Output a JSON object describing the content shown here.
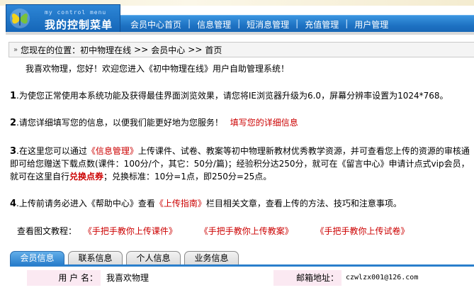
{
  "header": {
    "logo_en": "my control menu",
    "logo_cn": "我的控制菜单",
    "nav": [
      "会员中心首页",
      "信息管理",
      "短消息管理",
      "充值管理",
      "用户管理"
    ],
    "nav_separator": "|"
  },
  "breadcrumb": {
    "prefix": "您现在的位置：",
    "items": [
      "初中物理在线",
      "会员中心",
      "首页"
    ],
    "separator": ">>"
  },
  "content": {
    "greeting": "我喜欢物理，您好！欢迎您进入《初中物理在线》用户自助管理系统！",
    "item1": {
      "num": "1",
      "text": ".为使您正常使用本系统功能及获得最佳界面浏览效果，请您将IE浏览器升级为6.0，屏幕分辨率设置为1024*768。"
    },
    "item2": {
      "num": "2",
      "text": ".请您详细填写您的信息，以便我们能更好地为您服务！",
      "link": "填写您的详细信息"
    },
    "item3": {
      "num": "3",
      "text_a": ".在这里您可以通过",
      "link_a": "《信息管理》",
      "text_b": "上传课件、试卷、教案等初中物理新教材优秀教学资源，并可查看您上传的资源的审核通",
      "line2": "即可给您赠送下载点数(课件：100分/个，其它：50分/篇)；经验积分达250分，就可在《留言中心》申请计点式vip会员，",
      "line3_a": "就可在这里自行",
      "link_b": "兑换点券",
      "line3_b": "；兑换标准：10分=1点，即250分=25点。"
    },
    "item4": {
      "num": "4",
      "text_a": ".上传前请务必进入《帮助中心》查看",
      "link": "《上传指南》",
      "text_b": "栏目相关文章，查看上传的方法、技巧和注意事项。"
    },
    "tutorials": {
      "label": "查看图文教程：",
      "links": [
        "《手把手教你上传课件》",
        "《手把手教你上传教案》",
        "《手把手教你上传试卷》"
      ]
    }
  },
  "tabs": [
    "会员信息",
    "联系信息",
    "个人信息",
    "业务信息"
  ],
  "info": {
    "username_label": "用 户 名：",
    "username_value": "我喜欢物理",
    "email_label": "邮箱地址：",
    "email_value": "czwlzx001@126.com"
  },
  "colors": {
    "nav_blue": "#1d71c2",
    "link_red": "#cc0000",
    "label_pink": "#fbe9f2"
  },
  "icons": {
    "logo": "butterfly-logo-icon",
    "breadcrumb": "double-chevron-right-icon"
  }
}
